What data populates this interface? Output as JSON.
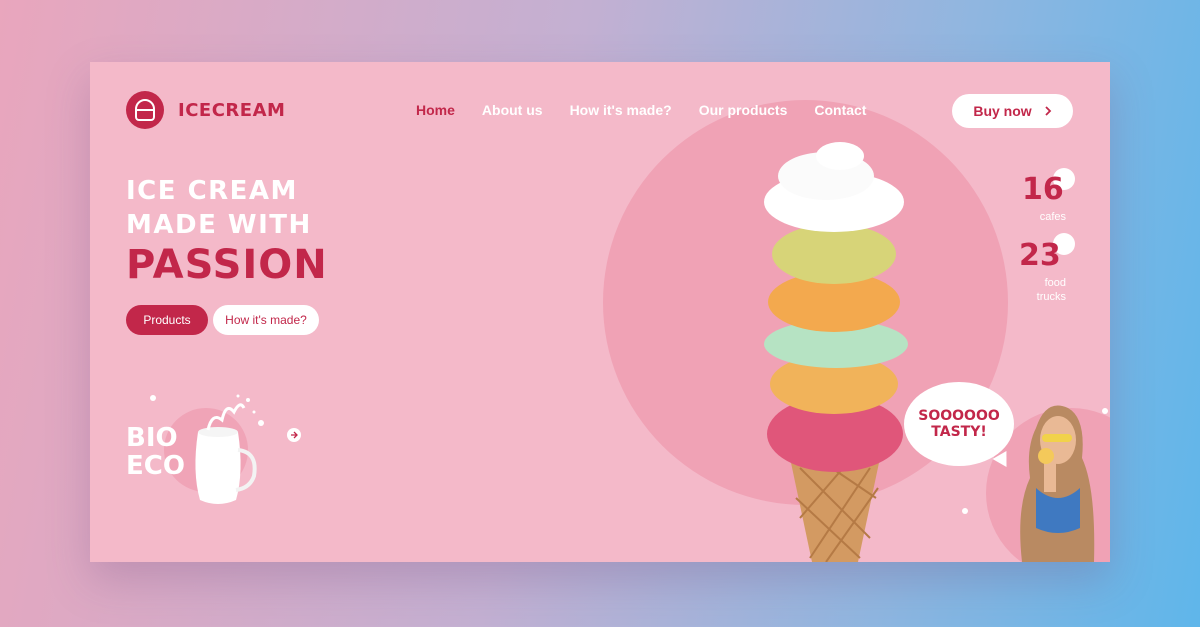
{
  "brand": {
    "name": "ICECREAM",
    "logo_icon": "ice-cream-logo-icon",
    "accent": "#c2274a",
    "background": "#f4b9c9"
  },
  "nav": {
    "items": [
      {
        "label": "Home",
        "active": true
      },
      {
        "label": "About us",
        "active": false
      },
      {
        "label": "How it's made?",
        "active": false
      },
      {
        "label": "Our products",
        "active": false
      },
      {
        "label": "Contact",
        "active": false
      }
    ],
    "cta": {
      "label": "Buy now",
      "icon": "chevron-right-icon"
    }
  },
  "hero": {
    "line1": "ICE CREAM",
    "line2": "MADE WITH",
    "line3": "PASSION",
    "primary_button": "Products",
    "secondary_button": "How it's made?"
  },
  "bio": {
    "text": "BIO\nECO",
    "arrow_icon": "arrow-right-icon"
  },
  "stats": [
    {
      "value": "16",
      "label": "cafes"
    },
    {
      "value": "23",
      "label": "food\ntrucks"
    }
  ],
  "bubble": {
    "text": "SOOOOOO\nTASTY!"
  }
}
